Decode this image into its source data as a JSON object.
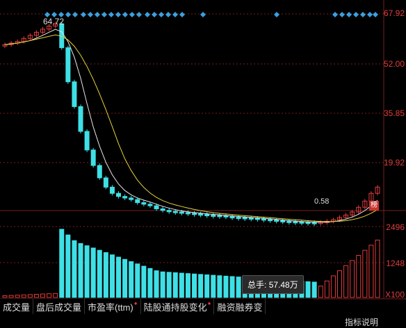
{
  "price_axis": {
    "ticks": [
      "67.92",
      "52.00",
      "35.85",
      "19.92"
    ]
  },
  "volume_axis": {
    "ticks": [
      "2496",
      "1248",
      "X100"
    ]
  },
  "annotations": {
    "peak": "64.72",
    "low": "0.58",
    "badge": "榜"
  },
  "tabs": [
    {
      "label": "成交量",
      "dot": false
    },
    {
      "label": "盘后成交量",
      "dot": false
    },
    {
      "label": "市盈率(ttm)",
      "dot": true
    },
    {
      "label": "陆股通持股变化",
      "dot": true
    },
    {
      "label": "融资融券变",
      "dot": false
    }
  ],
  "tooltip": {
    "label": "总手:",
    "value": "57.48万"
  },
  "footer": {
    "help": "指标说明"
  },
  "colors": {
    "up": "#e03c3c",
    "down": "#3ee0e6",
    "ma_white": "#e8e8e8",
    "ma_yellow": "#e6d23a",
    "marker": "#3aa0e0"
  },
  "chart_data": {
    "type": "candlestick",
    "price_ylim": [
      0,
      67.92
    ],
    "price_ticks": [
      67.92,
      52.0,
      35.85,
      19.92
    ],
    "peak": 64.72,
    "low": 0.58,
    "approx_closes": [
      58,
      58.5,
      59,
      60,
      61,
      62,
      63,
      64,
      64.7,
      57,
      46,
      38,
      30,
      24,
      19,
      15,
      12,
      10,
      9,
      8.5,
      8,
      7,
      6.5,
      6,
      5,
      4.5,
      4.2,
      4,
      3.8,
      3.6,
      3.4,
      3.2,
      3,
      2.9,
      2.8,
      2.5,
      2.3,
      2.2,
      2.1,
      2.0,
      1.8,
      1.6,
      1.4,
      1.2,
      1.0,
      0.9,
      0.8,
      0.7,
      0.6,
      0.58,
      0.7,
      1.0,
      1.5,
      2.2,
      3.0,
      4.0,
      5.5,
      7.5,
      10,
      12
    ],
    "volume_ylim": [
      0,
      2496
    ],
    "volume_ticks": [
      2496,
      1248
    ],
    "volume_unit": "X100"
  }
}
